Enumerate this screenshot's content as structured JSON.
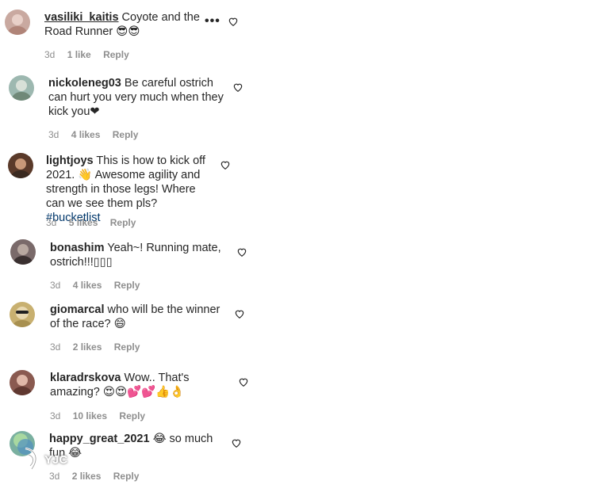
{
  "comments": [
    {
      "username": "vasiliki_kaitis",
      "text": "Coyote and the Road Runner 😎😎",
      "time": "3d",
      "likes": "1 like",
      "reply": "Reply",
      "more": "•••",
      "avatar_color": "#c9a9a0"
    },
    {
      "username": "nickoleneg03",
      "text": "Be careful ostrich can hurt you very much when they kick you❤",
      "time": "3d",
      "likes": "4 likes",
      "reply": "Reply",
      "avatar_color": "#9db8b0"
    },
    {
      "username": "lightjoys",
      "text_before": "This is how to kick off 2021. 👋 Awesome agility and strength in those legs! Where can we see them pls?",
      "hashtag": "#bucketlist",
      "time": "3d",
      "likes": "5 likes",
      "reply": "Reply",
      "avatar_color": "#5a3a2a"
    },
    {
      "username": "bonashim",
      "text": "Yeah~! Running mate, ostrich!!!▯▯▯",
      "time": "3d",
      "likes": "4 likes",
      "reply": "Reply",
      "avatar_color": "#7a6a6a"
    },
    {
      "username": "giomarcal",
      "text": "who will be the winner of the race? 😄",
      "time": "3d",
      "likes": "2 likes",
      "reply": "Reply",
      "avatar_color": "#c8b070"
    },
    {
      "username": "klaradrskova",
      "text": "Wow.. That's amazing? 😍😍💕💕👍👌",
      "time": "3d",
      "likes": "10 likes",
      "reply": "Reply",
      "avatar_color": "#8a5a50"
    },
    {
      "username": "happy_great_2021",
      "text": "😂 so much fun 😂",
      "time": "3d",
      "likes": "2 likes",
      "reply": "Reply",
      "avatar_color": "#7ab0a0"
    }
  ],
  "watermark": "YJC"
}
